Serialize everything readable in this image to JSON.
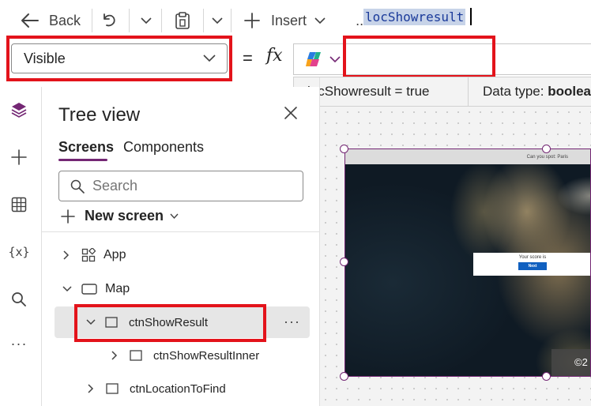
{
  "toolbar": {
    "back_label": "Back",
    "insert_label": "Insert",
    "more_label": "..."
  },
  "formula_bar": {
    "property": "Visible",
    "equals": "=",
    "fx": "fx",
    "formula": "locShowresult"
  },
  "intellisense": {
    "result": "locShowresult  =  true",
    "data_type_label": "Data type: ",
    "data_type_value": "boolea"
  },
  "tree_view": {
    "title": "Tree view",
    "tabs": [
      {
        "label": "Screens",
        "active": true
      },
      {
        "label": "Components",
        "active": false
      }
    ],
    "search_placeholder": "Search",
    "new_screen_label": "New screen",
    "nodes": [
      {
        "label": "App",
        "icon": "app-icon"
      },
      {
        "label": "Map",
        "icon": "screen-icon"
      },
      {
        "label": "ctnShowResult",
        "icon": "container-icon",
        "selected": true
      },
      {
        "label": "ctnShowResultInner",
        "icon": "container-icon"
      },
      {
        "label": "ctnLocationToFind",
        "icon": "container-icon"
      }
    ],
    "more_options": "···"
  },
  "canvas": {
    "header_text": "Can you spot: Paris",
    "score_text": "Your score is",
    "next_label": "Next",
    "copyright": "©2"
  },
  "colors": {
    "accent": "#742774",
    "highlight": "#e3131b",
    "formula_text": "#1a3a9a",
    "formula_selection": "#c7d3e8"
  }
}
